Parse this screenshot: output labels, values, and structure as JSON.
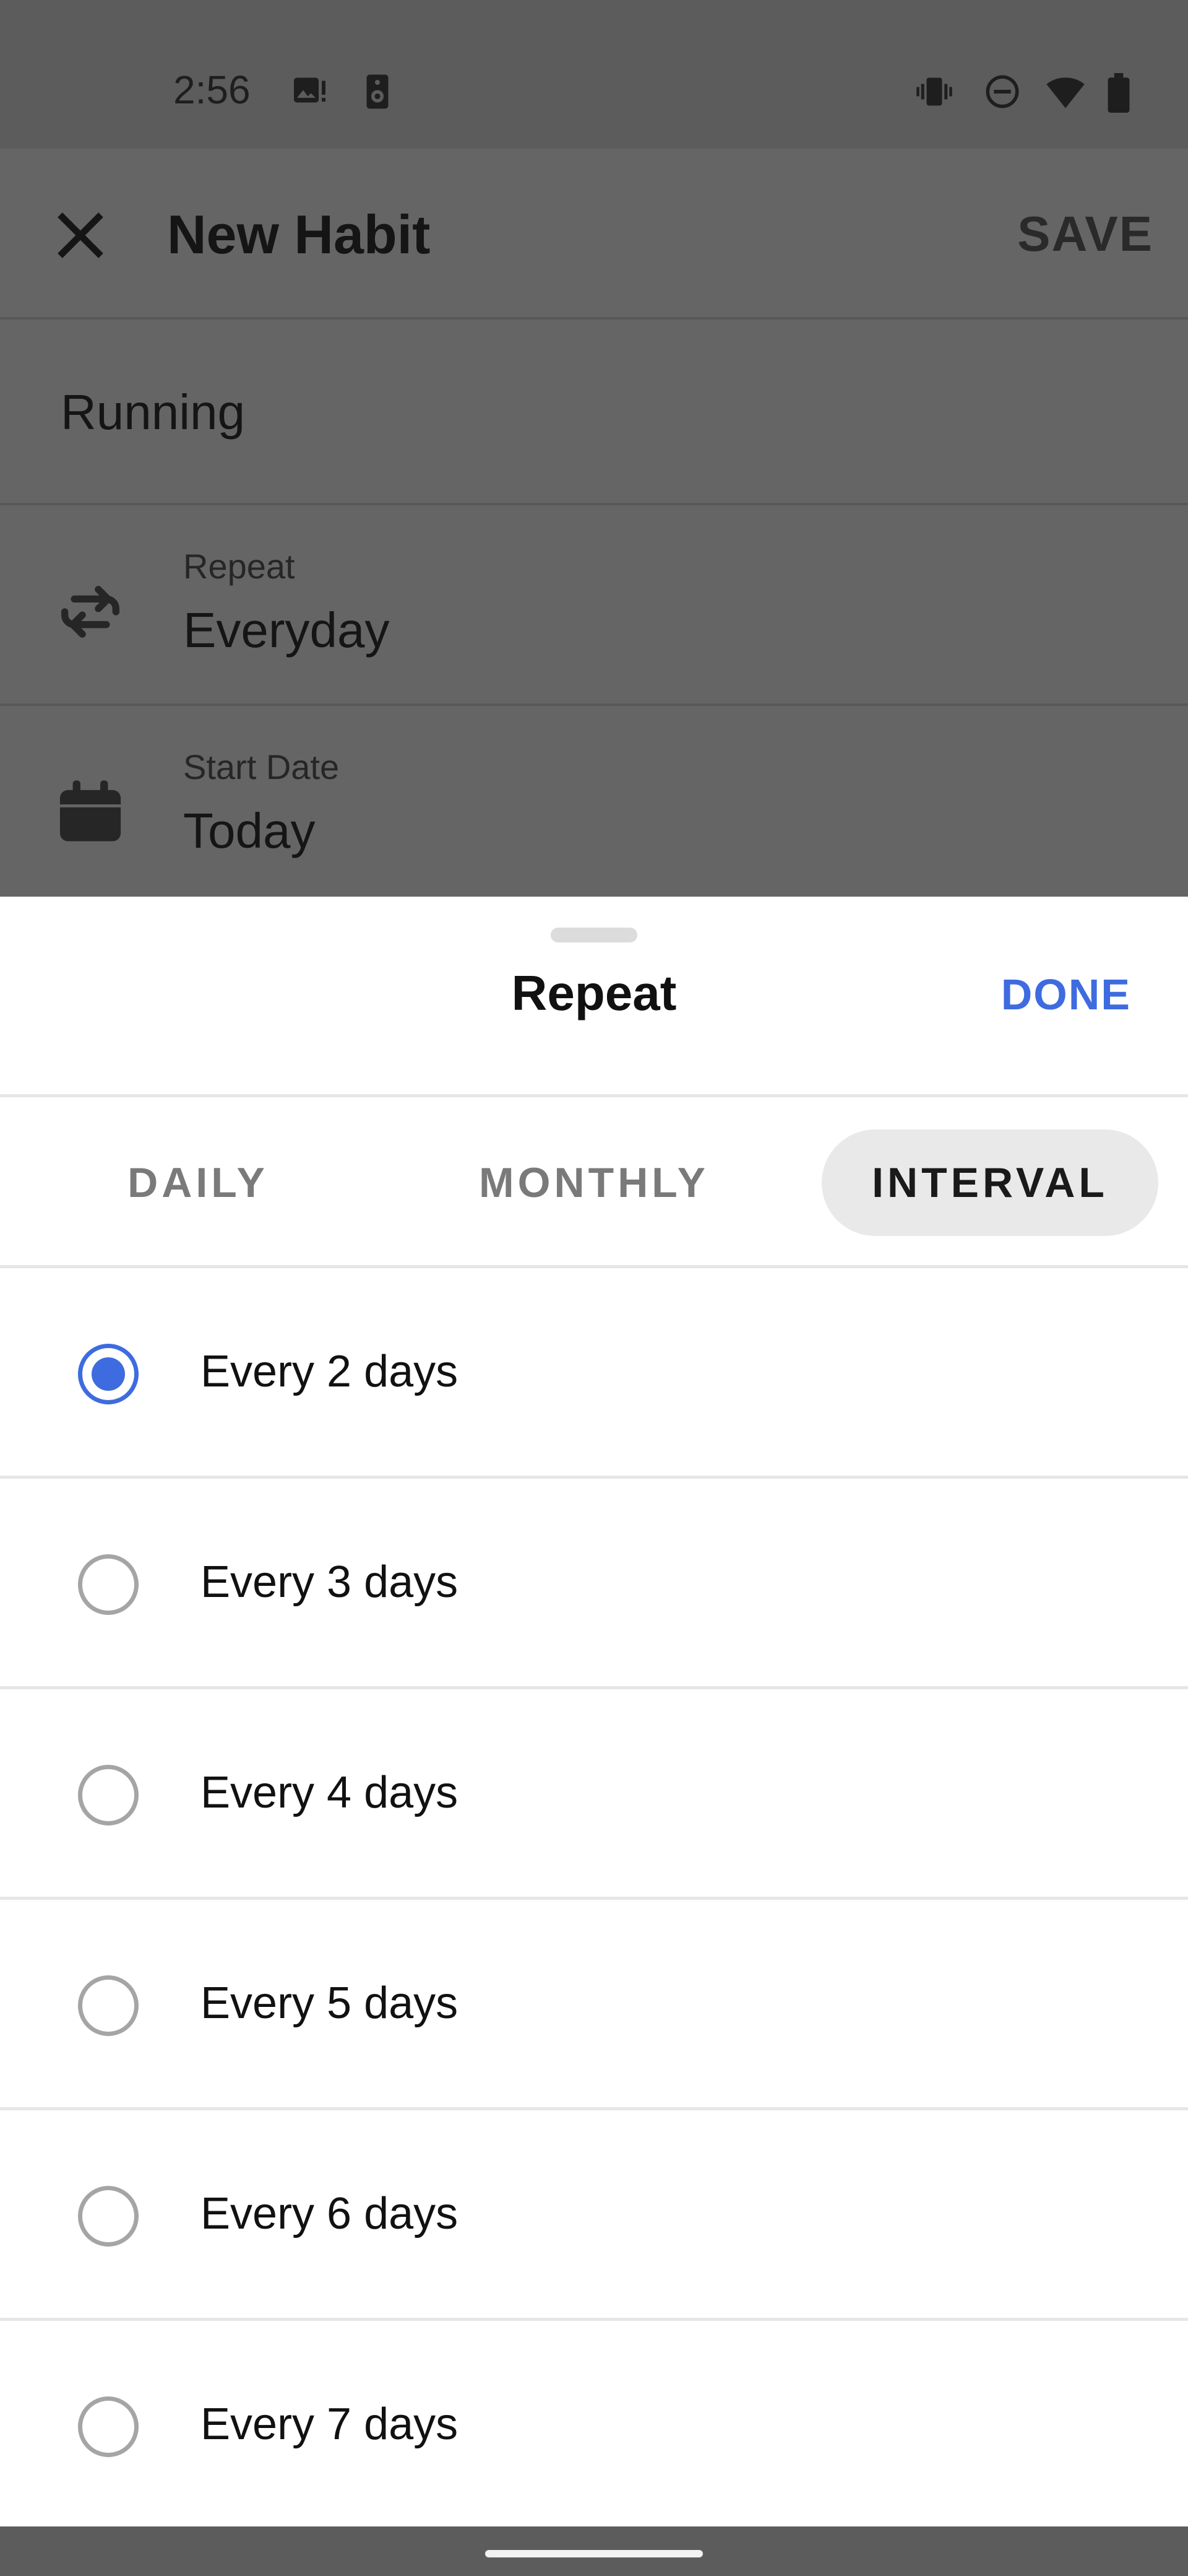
{
  "status_bar": {
    "time": "2:56",
    "left_icons": [
      "image-alert-icon",
      "speaker-icon"
    ],
    "right_icons": [
      "vibrate-icon",
      "do-not-disturb-icon",
      "wifi-icon",
      "battery-icon"
    ]
  },
  "app_bar": {
    "title": "New Habit",
    "save_label": "SAVE",
    "close_icon": "close-icon"
  },
  "form": {
    "habit_name": "Running",
    "repeat": {
      "label": "Repeat",
      "value": "Everyday",
      "icon": "repeat-icon"
    },
    "start_date": {
      "label": "Start Date",
      "value": "Today",
      "icon": "calendar-icon"
    }
  },
  "sheet": {
    "title": "Repeat",
    "done_label": "DONE",
    "tabs": [
      {
        "label": "DAILY",
        "active": false
      },
      {
        "label": "MONTHLY",
        "active": false
      },
      {
        "label": "INTERVAL",
        "active": true
      }
    ],
    "options": [
      {
        "label": "Every 2 days",
        "selected": true
      },
      {
        "label": "Every 3 days",
        "selected": false
      },
      {
        "label": "Every 4 days",
        "selected": false
      },
      {
        "label": "Every 5 days",
        "selected": false
      },
      {
        "label": "Every 6 days",
        "selected": false
      },
      {
        "label": "Every 7 days",
        "selected": false
      }
    ]
  },
  "colors": {
    "accent": "#3e6bdf",
    "scrim": "#656565",
    "sheet_background": "#ffffff",
    "divider": "#e6e6e6",
    "active_tab_background": "#e9e9e9"
  }
}
